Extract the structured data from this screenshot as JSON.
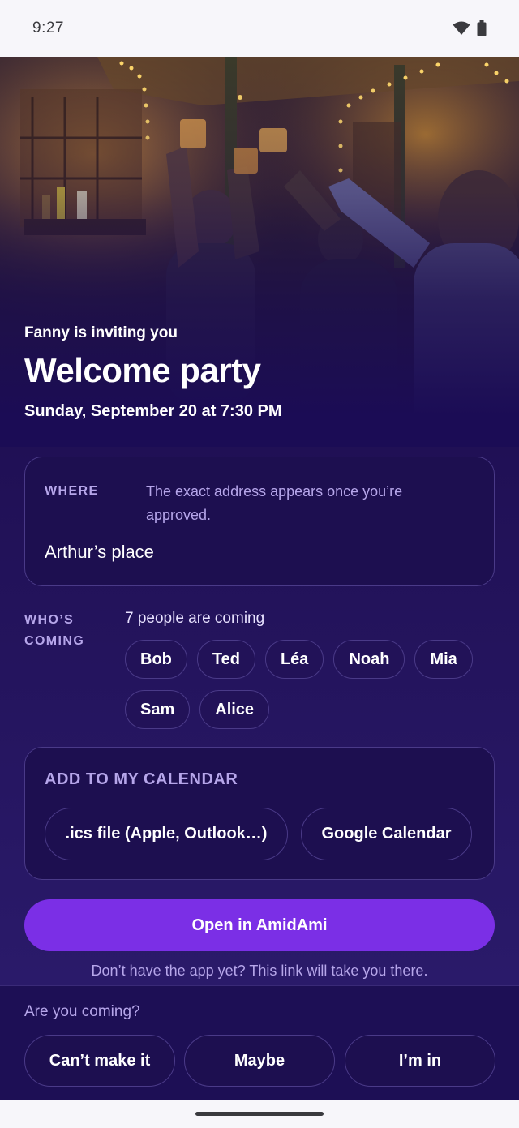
{
  "status_bar": {
    "time": "9:27"
  },
  "event": {
    "inviter_line": "Fanny is inviting you",
    "title": "Welcome party",
    "date_line": "Sunday, September 20 at 7:30 PM"
  },
  "where": {
    "label": "WHERE",
    "note": "The exact address appears once you’re approved.",
    "place": "Arthur’s place"
  },
  "whos_coming": {
    "label": "WHO’S COMING",
    "count_text": "7 people are coming",
    "attendees": [
      "Bob",
      "Ted",
      "Léa",
      "Noah",
      "Mia",
      "Sam",
      "Alice"
    ]
  },
  "calendar": {
    "title": "ADD TO MY CALENDAR",
    "ics_label": ".ics file (Apple, Outlook…)",
    "google_label": "Google Calendar"
  },
  "open_app": {
    "button_label": "Open in AmidAmi",
    "note": "Don’t have the app yet? This link will take you there."
  },
  "rsvp": {
    "question": "Are you coming?",
    "decline_label": "Can’t make it",
    "maybe_label": "Maybe",
    "accept_label": "I’m in"
  },
  "colors": {
    "accent": "#7b2fe6",
    "background": "#201055",
    "muted_text": "#b6a6ea"
  }
}
